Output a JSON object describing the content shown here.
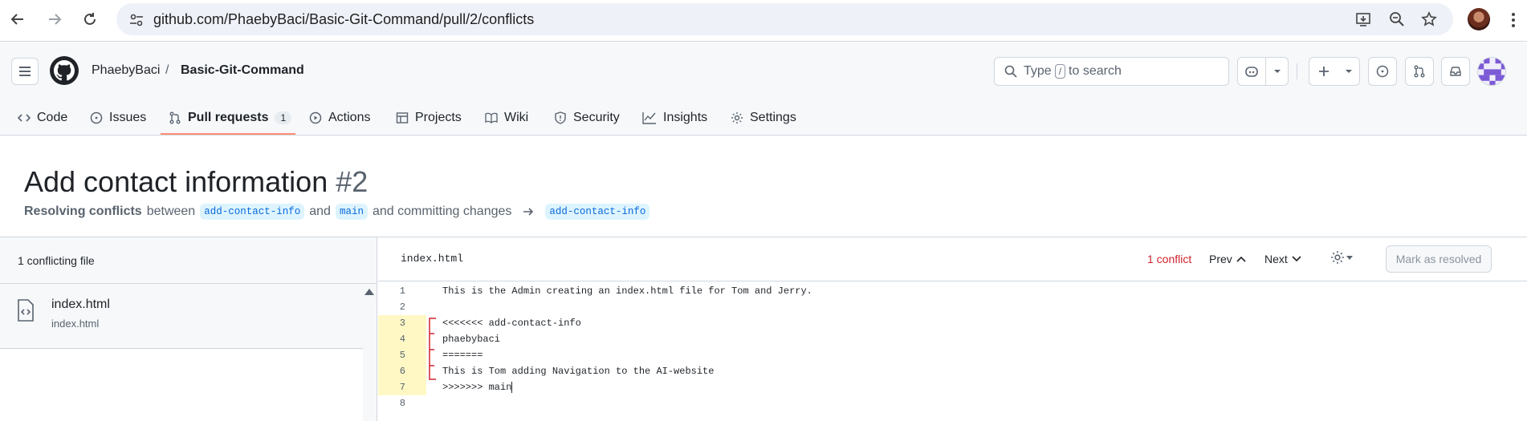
{
  "browser": {
    "url": "github.com/PhaebyBaci/Basic-Git-Command/pull/2/conflicts",
    "icons": [
      "back-icon",
      "forward-icon",
      "reload-icon",
      "site-info-icon",
      "install-icon",
      "zoom-icon",
      "bookmark-star-icon",
      "profile-icon",
      "menu-kebab-icon"
    ]
  },
  "header": {
    "owner": "PhaebyBaci",
    "separator": "/",
    "repo": "Basic-Git-Command",
    "search": {
      "prefix": "Type",
      "key": "/",
      "suffix": "to search"
    }
  },
  "tabs": [
    {
      "label": "Code",
      "icon": "code-icon"
    },
    {
      "label": "Issues",
      "icon": "issue-icon"
    },
    {
      "label": "Pull requests",
      "icon": "pull-request-icon",
      "count": "1",
      "active": true
    },
    {
      "label": "Actions",
      "icon": "play-icon"
    },
    {
      "label": "Projects",
      "icon": "table-icon"
    },
    {
      "label": "Wiki",
      "icon": "book-icon"
    },
    {
      "label": "Security",
      "icon": "shield-icon"
    },
    {
      "label": "Insights",
      "icon": "graph-icon"
    },
    {
      "label": "Settings",
      "icon": "gear-icon"
    }
  ],
  "pr": {
    "title": "Add contact information",
    "number": "#2",
    "sub_strong": "Resolving conflicts",
    "sub_between": "between",
    "head_branch": "add-contact-info",
    "sub_and": "and",
    "base_branch": "main",
    "sub_committing": "and committing changes",
    "target_branch": "add-contact-info"
  },
  "files_pane": {
    "header": "1 conflicting file",
    "file_name": "index.html",
    "file_path": "index.html"
  },
  "editor": {
    "file_name": "index.html",
    "conflict_count": "1 conflict",
    "prev_label": "Prev",
    "next_label": "Next",
    "mark_resolved_label": "Mark as resolved",
    "lines": [
      {
        "n": "1",
        "text": "This is the Admin creating an index.html file for Tom and Jerry.",
        "conflict": false
      },
      {
        "n": "2",
        "text": "",
        "conflict": false
      },
      {
        "n": "3",
        "text": "<<<<<<< add-contact-info",
        "conflict": true
      },
      {
        "n": "4",
        "text": "phaebybaci",
        "conflict": true
      },
      {
        "n": "5",
        "text": "=======",
        "conflict": true
      },
      {
        "n": "6",
        "text": "This is Tom adding Navigation to the AI-website",
        "conflict": true
      },
      {
        "n": "7",
        "text": ">>>>>>> main",
        "conflict": true
      },
      {
        "n": "8",
        "text": "",
        "conflict": false
      }
    ]
  },
  "colors": {
    "accent_underline": "#fd8c73",
    "conflict_text": "#cf222e",
    "branch_bg": "#ddf4ff",
    "branch_fg": "#0969da",
    "conflict_gutter": "#fff8c5"
  }
}
